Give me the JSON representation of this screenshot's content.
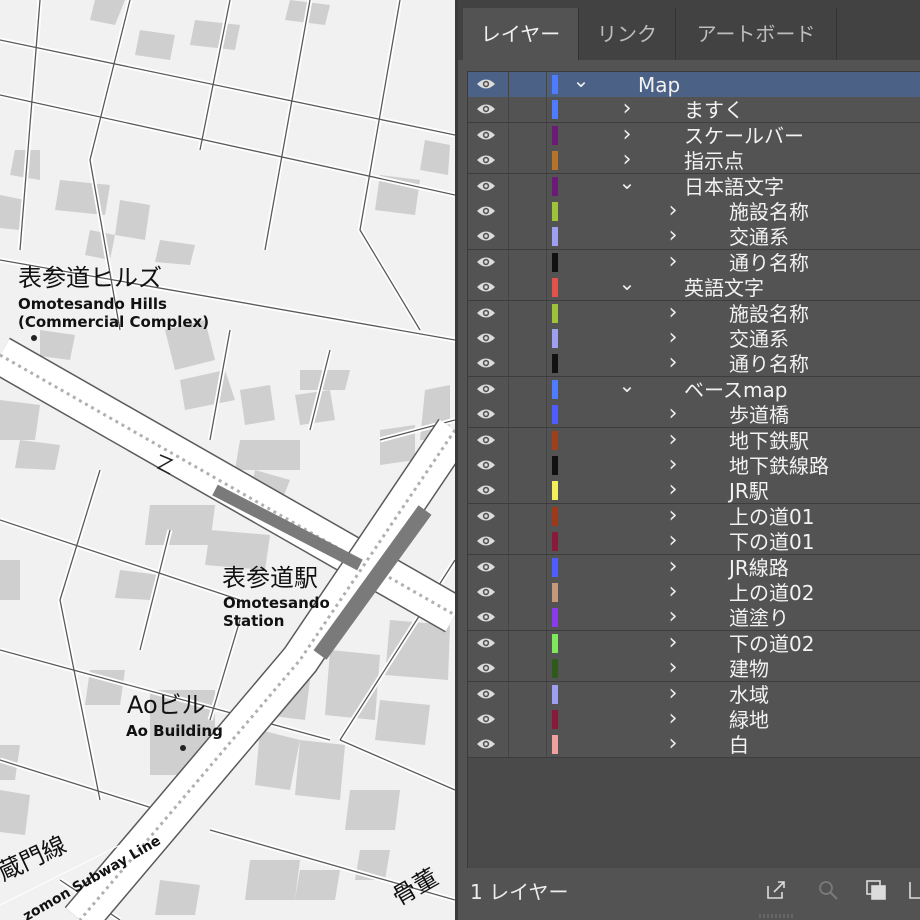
{
  "map": {
    "labels": {
      "hills_jp": "表参道ヒルズ",
      "hills_en1": "Omotesando Hills",
      "hills_en2": "(Commercial Complex)",
      "station_jp": "表参道駅",
      "station_en1": "Omotesando",
      "station_en2": "Station",
      "ao_jp": "Aoビル",
      "ao_en": "Ao Building",
      "line_jp": "蔵門線",
      "line_en": "zomon Subway Line",
      "corner_jp": "骨董"
    }
  },
  "panel": {
    "tabs": [
      "レイヤー",
      "リンク",
      "アートボード"
    ],
    "footer_count": "1 レイヤー",
    "layers": [
      {
        "name": "Map",
        "color": "#4f7cff",
        "level": 0,
        "expanded": true,
        "selected": true
      },
      {
        "name": "ますく",
        "color": "#4f7cff",
        "level": 1,
        "expanded": false
      },
      {
        "name": "スケールバー",
        "color": "#6b1a78",
        "level": 1,
        "expanded": false
      },
      {
        "name": "指示点",
        "color": "#b8732a",
        "level": 1,
        "expanded": false
      },
      {
        "name": "日本語文字",
        "color": "#6b1a78",
        "level": 1,
        "expanded": true
      },
      {
        "name": "施設名称",
        "color": "#9ec23a",
        "level": 2,
        "expanded": false
      },
      {
        "name": "交通系",
        "color": "#9f9ff2",
        "level": 2,
        "expanded": false
      },
      {
        "name": "通り名称",
        "color": "#111111",
        "level": 2,
        "expanded": false
      },
      {
        "name": "英語文字",
        "color": "#e0524b",
        "level": 1,
        "expanded": true
      },
      {
        "name": "施設名称",
        "color": "#9ec23a",
        "level": 2,
        "expanded": false
      },
      {
        "name": "交通系",
        "color": "#9f9ff2",
        "level": 2,
        "expanded": false
      },
      {
        "name": "通り名称",
        "color": "#111111",
        "level": 2,
        "expanded": false
      },
      {
        "name": "ベースmap",
        "color": "#4f7cff",
        "level": 1,
        "expanded": true
      },
      {
        "name": "歩道橋",
        "color": "#4f5cff",
        "level": 2,
        "expanded": false
      },
      {
        "name": "地下鉄駅",
        "color": "#a0401a",
        "level": 2,
        "expanded": false
      },
      {
        "name": "地下鉄線路",
        "color": "#111111",
        "level": 2,
        "expanded": false
      },
      {
        "name": "JR駅",
        "color": "#f2ef5a",
        "level": 2,
        "expanded": false
      },
      {
        "name": "上の道01",
        "color": "#9e3a1a",
        "level": 2,
        "expanded": false
      },
      {
        "name": "下の道01",
        "color": "#8a1a3a",
        "level": 2,
        "expanded": false
      },
      {
        "name": "JR線路",
        "color": "#4f5cff",
        "level": 2,
        "expanded": false
      },
      {
        "name": "上の道02",
        "color": "#c4987a",
        "level": 2,
        "expanded": false
      },
      {
        "name": "道塗り",
        "color": "#8a3ae8",
        "level": 2,
        "expanded": false
      },
      {
        "name": "下の道02",
        "color": "#7ee85a",
        "level": 2,
        "expanded": false
      },
      {
        "name": "建物",
        "color": "#2e5a1a",
        "level": 2,
        "expanded": false
      },
      {
        "name": "水域",
        "color": "#9f9ff2",
        "level": 2,
        "expanded": false
      },
      {
        "name": "緑地",
        "color": "#8a1a3a",
        "level": 2,
        "expanded": false
      },
      {
        "name": "白",
        "color": "#f0a0a0",
        "level": 2,
        "expanded": false
      }
    ]
  }
}
